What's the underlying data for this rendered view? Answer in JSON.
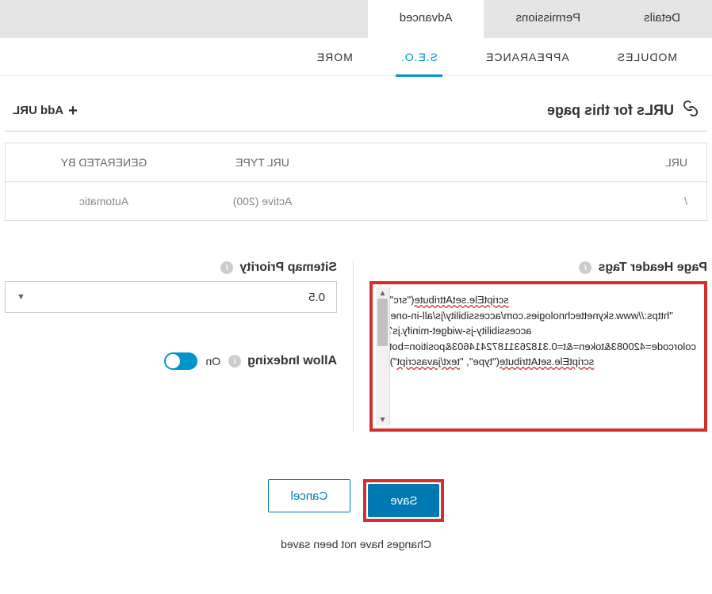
{
  "main_tabs": {
    "details": "Details",
    "permissions": "Permissions",
    "advanced": "Advanced"
  },
  "sub_tabs": {
    "modules": "MODULES",
    "appearance": "APPEARANCE",
    "seo": "S.E.O.",
    "more": "MORE"
  },
  "section": {
    "title": "URLs for this page",
    "add_url": "Add URL"
  },
  "table": {
    "headers": {
      "url": "URL",
      "type": "URL TYPE",
      "generated": "GENERATED BY"
    },
    "rows": [
      {
        "url": "/",
        "type": "Active (200)",
        "generated": "Automatic"
      }
    ]
  },
  "header_tags": {
    "label": "Page Header Tags",
    "content": "scriptEle.setAttribute(\"src\", \"https://www.skynettechnologies.com/accessibility/js/all-in-one-accessibility-js-widget-minify.js?colorcode=420083&token=&t=0.31826311872414603&position=bottom_right&\");\nscriptEle.setAttribute(\"type\", \"text/javascript\");"
  },
  "sitemap": {
    "label": "Sitemap Priority",
    "value": "0.5"
  },
  "indexing": {
    "label": "Allow Indexing",
    "state": "On"
  },
  "buttons": {
    "save": "Save",
    "cancel": "Cancel"
  },
  "footer": "Changes have not been saved"
}
